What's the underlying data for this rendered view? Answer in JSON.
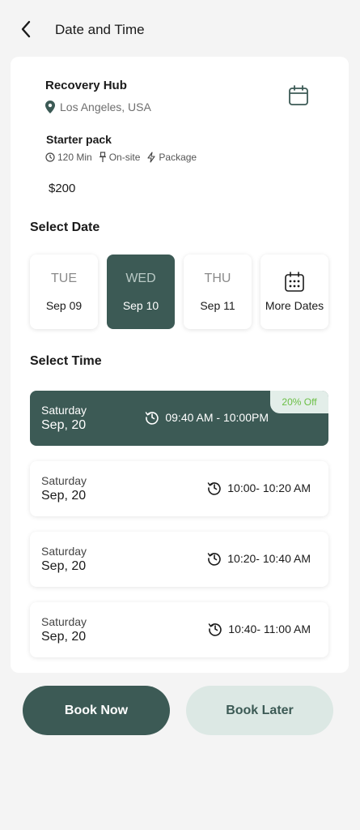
{
  "header": {
    "title": "Date and Time",
    "back_icon": "chevron-left-icon"
  },
  "venue": {
    "name": "Recovery Hub",
    "location": "Los Angeles, USA",
    "location_icon": "map-pin-icon",
    "calendar_icon": "calendar-icon"
  },
  "package": {
    "name": "Starter pack",
    "duration": "120 Min",
    "mode": "On-site",
    "type": "Package",
    "price": "$200"
  },
  "select_date": {
    "title": "Select Date",
    "dates": [
      {
        "dow": "TUE",
        "day": "Sep 09",
        "selected": false
      },
      {
        "dow": "WED",
        "day": "Sep 10",
        "selected": true
      },
      {
        "dow": "THU",
        "day": "Sep 11",
        "selected": false
      }
    ],
    "more_dates_label": "More Dates"
  },
  "select_time": {
    "title": "Select Time",
    "slots": [
      {
        "day": "Saturday",
        "date": "Sep, 20",
        "time": "09:40 AM - 10:00PM",
        "selected": true,
        "badge": "20% Off"
      },
      {
        "day": "Saturday",
        "date": "Sep, 20",
        "time": "10:00- 10:20 AM",
        "selected": false
      },
      {
        "day": "Saturday",
        "date": "Sep, 20",
        "time": "10:20- 10:40 AM",
        "selected": false
      },
      {
        "day": "Saturday",
        "date": "Sep, 20",
        "time": "10:40- 11:00 AM",
        "selected": false
      }
    ]
  },
  "actions": {
    "book_now": "Book Now",
    "book_later": "Book Later"
  },
  "colors": {
    "primary": "#3c5a55",
    "secondary": "#dce8e4",
    "badge_text": "#6bbf45"
  }
}
